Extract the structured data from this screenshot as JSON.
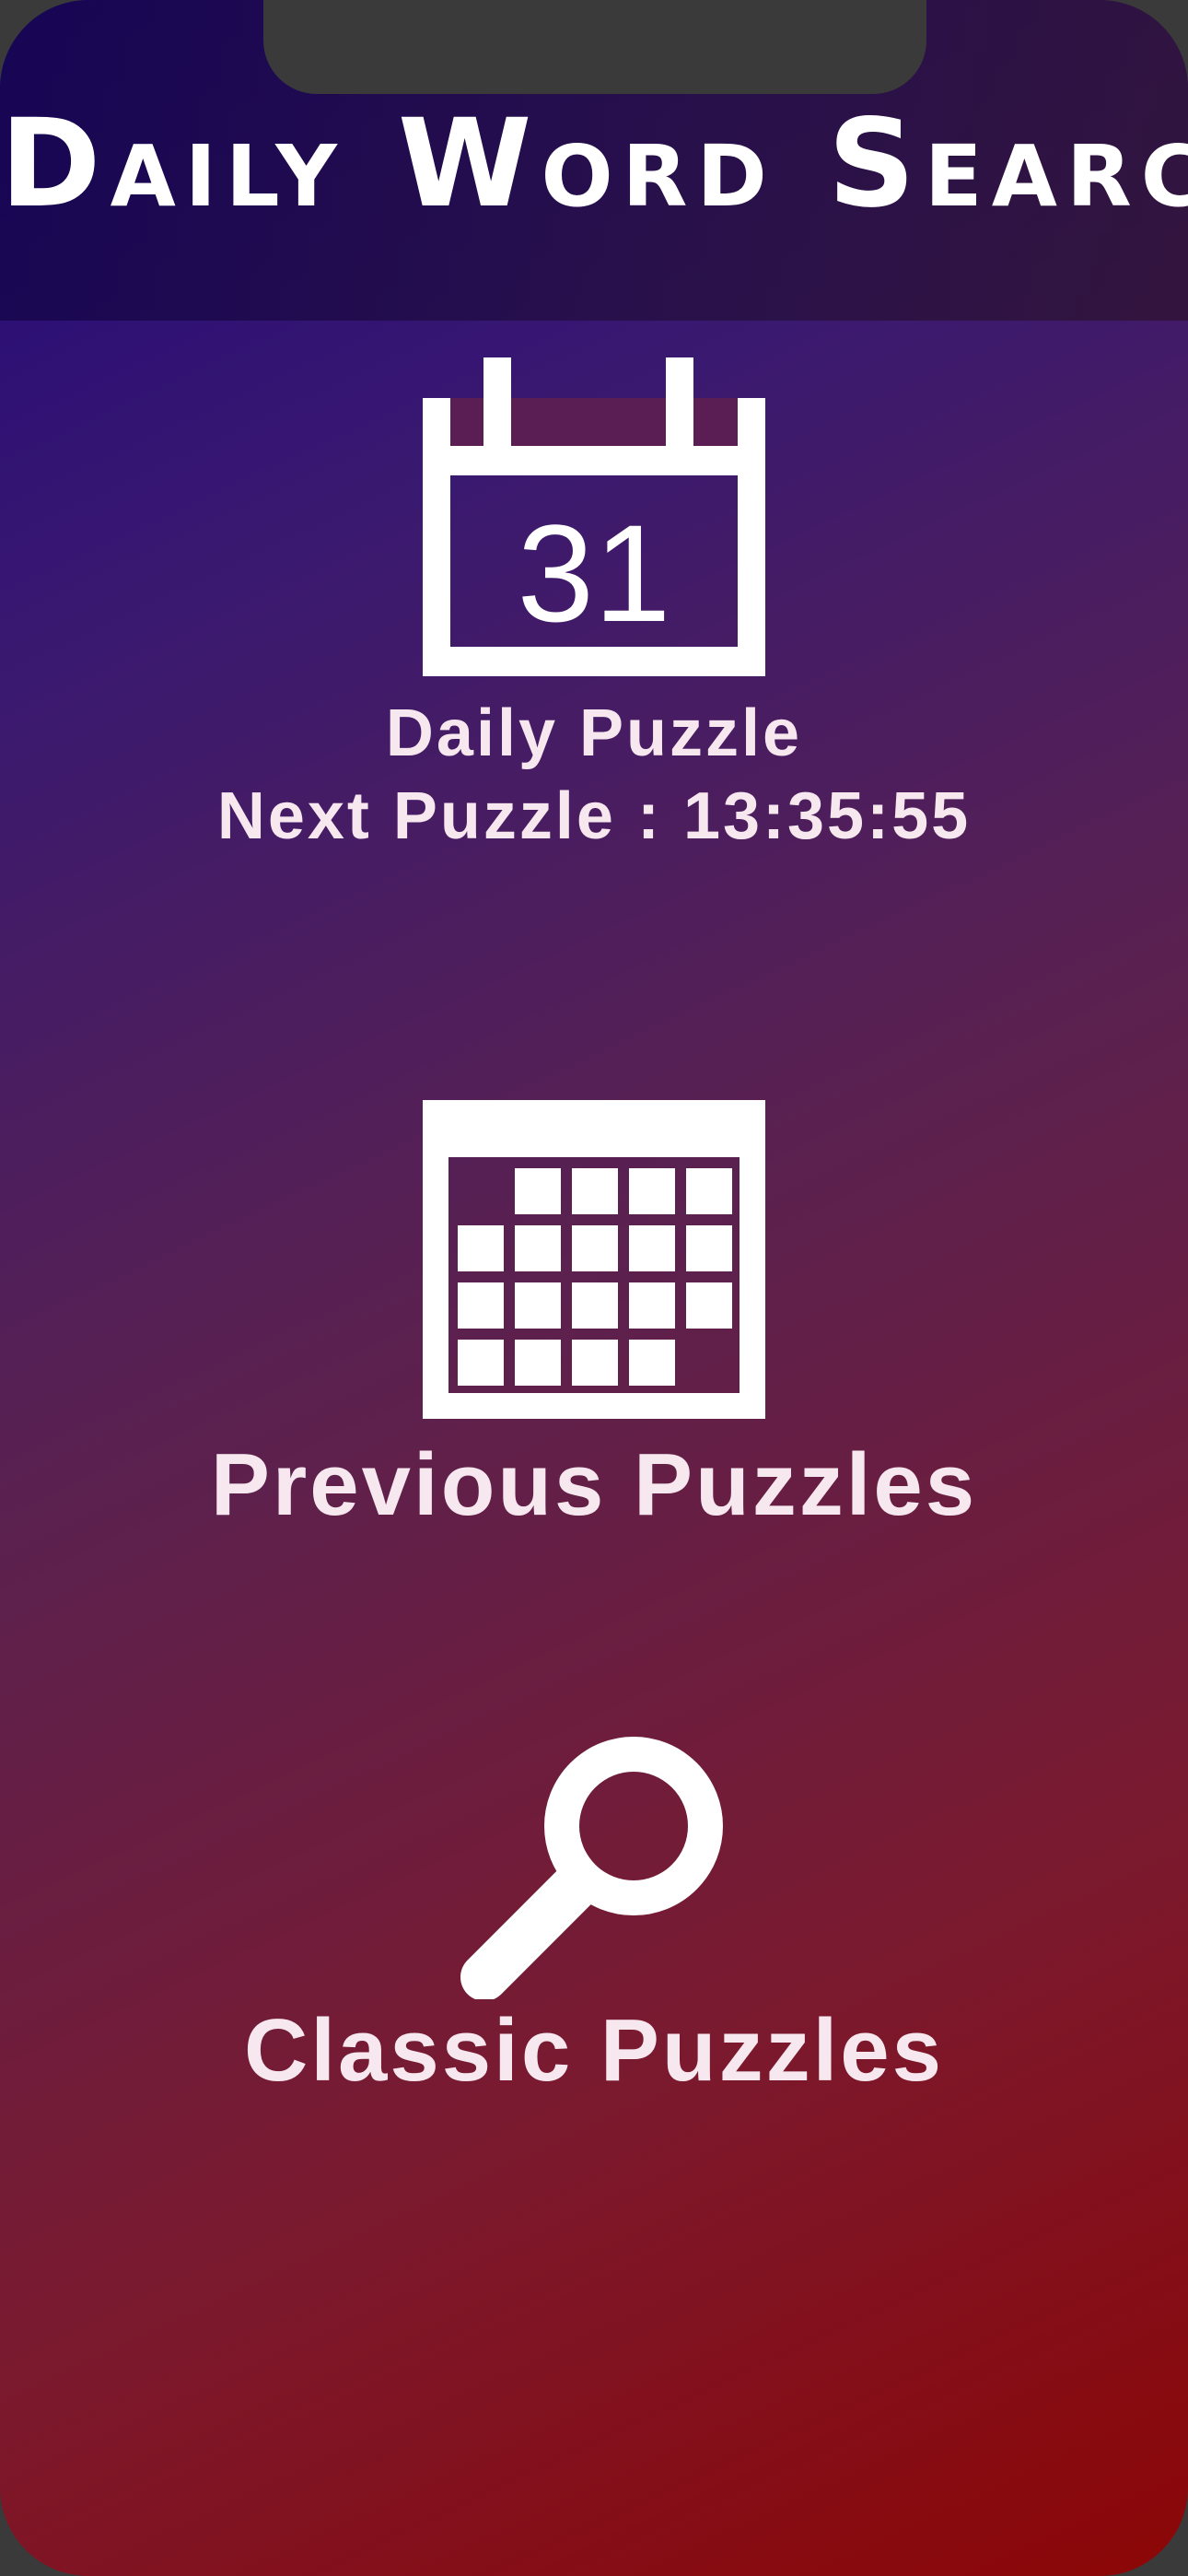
{
  "app": {
    "title": "Daily Word Search"
  },
  "menu": {
    "daily": {
      "icon": "calendar-day-icon",
      "icon_day": "31",
      "label": "Daily Puzzle",
      "countdown_label": "Next Puzzle : 13:35:55"
    },
    "previous": {
      "icon": "calendar-month-icon",
      "label": "Previous Puzzles"
    },
    "classic": {
      "icon": "magnifier-icon",
      "label": "Classic Puzzles"
    }
  },
  "colors": {
    "gradient_start": "#22087a",
    "gradient_end": "#8c0606",
    "text": "#f6e8ee",
    "icon": "#ffffff"
  }
}
